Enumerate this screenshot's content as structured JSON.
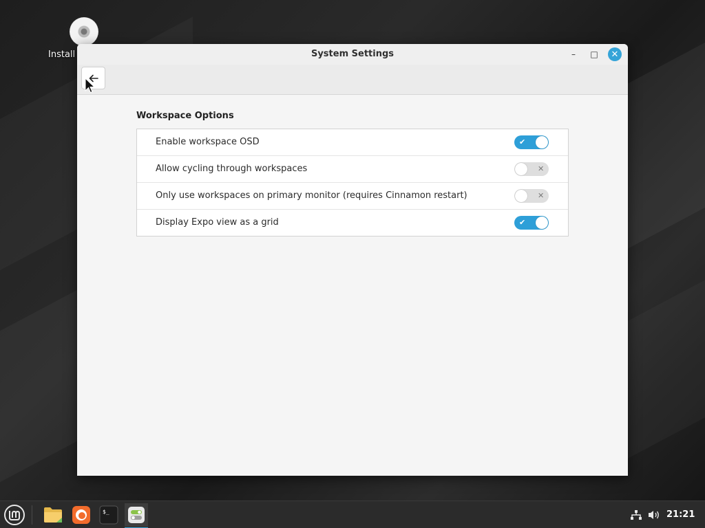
{
  "desktop": {
    "icon_label": "Install"
  },
  "window": {
    "title": "System Settings",
    "controls": {
      "minimize": "–",
      "maximize": "□",
      "close": "✕"
    },
    "back_icon": "arrow-left-icon",
    "section_title": "Workspace Options",
    "options": [
      {
        "label": "Enable workspace OSD",
        "enabled": true
      },
      {
        "label": "Allow cycling through workspaces",
        "enabled": false
      },
      {
        "label": "Only use workspaces on primary monitor (requires Cinnamon restart)",
        "enabled": false
      },
      {
        "label": "Display Expo view as a grid",
        "enabled": true
      }
    ],
    "switch_marks": {
      "on": "✔",
      "off": "✕"
    },
    "accent_color": "#2e9fd8"
  },
  "taskbar": {
    "clock": "21:21",
    "items": [
      {
        "name": "files-icon"
      },
      {
        "name": "firefox-icon"
      },
      {
        "name": "terminal-icon"
      },
      {
        "name": "system-settings-icon",
        "active": true
      }
    ],
    "tray": [
      "network-icon",
      "volume-icon"
    ]
  }
}
